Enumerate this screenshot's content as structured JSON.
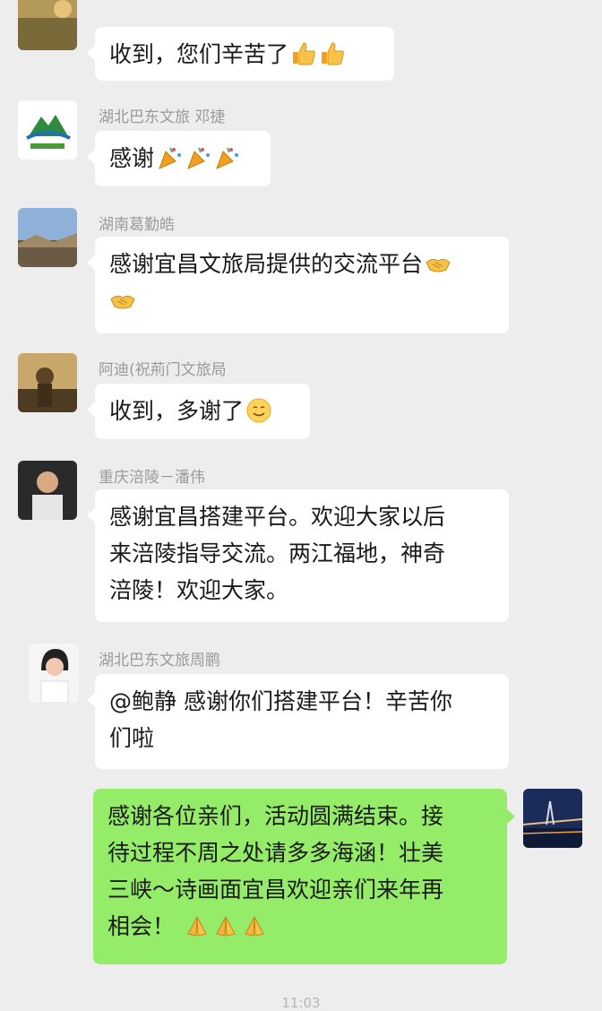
{
  "messages": [
    {
      "sender": "",
      "text": "收到，您们辛苦了",
      "emoji": [
        "thumbs-up-icon",
        "thumbs-up-icon"
      ]
    },
    {
      "sender": "湖北巴东文旅   邓捷",
      "text": "感谢",
      "emoji": [
        "party-popper-icon",
        "party-popper-icon",
        "party-popper-icon"
      ]
    },
    {
      "sender": "湖南葛勤皓",
      "text": "感谢宜昌文旅局提供的交流平台",
      "emoji": [
        "handshake-icon",
        "handshake-icon"
      ]
    },
    {
      "sender": "阿迪(祝荊门文旅局",
      "text": "收到，多谢了",
      "emoji": [
        "smile-icon"
      ]
    },
    {
      "sender": "重庆涪陵－潘伟",
      "text_lines": [
        "感谢宜昌搭建平台。欢迎大家以后",
        "来涪陵指导交流。两江福地，神奇",
        "涪陵！欢迎大家。"
      ]
    },
    {
      "sender": "湖北巴东文旅周鹏",
      "text_lines": [
        "@鲍静  感谢你们搭建平台！辛苦你",
        "们啦"
      ]
    },
    {
      "sender": "",
      "mine": true,
      "text_lines": [
        "感谢各位亲们，活动圆满结束。接",
        "待过程不周之处请多多海涵！壮美",
        "三峡～诗画面宜昌欢迎亲们来年再",
        "相会！"
      ],
      "emoji": [
        "praying-hands-icon",
        "praying-hands-icon",
        "praying-hands-icon"
      ]
    }
  ],
  "footer": {
    "time": "11:03"
  },
  "colors": {
    "background": "#ededed",
    "bubble_incoming": "#ffffff",
    "bubble_outgoing": "#95ec69",
    "sender_name": "#9a9a9a"
  }
}
